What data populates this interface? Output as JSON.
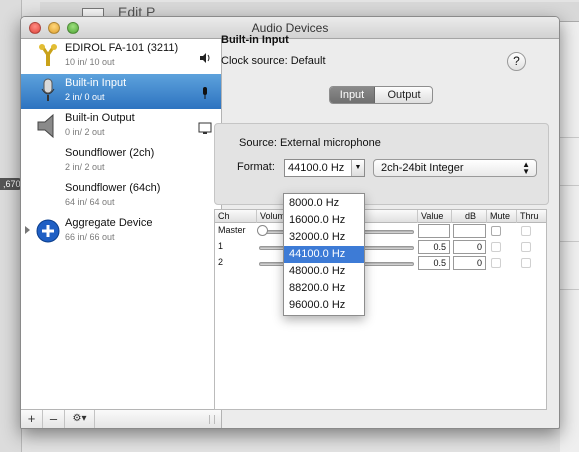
{
  "window": {
    "title": "Audio Devices"
  },
  "background_app": {
    "partial_title": "Edit P",
    "left_badge": ",670"
  },
  "sidebar": {
    "devices": [
      {
        "name": "EDIROL FA-101 (3211)",
        "io": "10 in/ 10 out",
        "icon": "usb-audio-icon",
        "badge": "speaker-icon",
        "selected": false
      },
      {
        "name": "Built-in Input",
        "io": "2 in/ 0 out",
        "icon": "microphone-icon",
        "badge": "microphone-badge-icon",
        "selected": true
      },
      {
        "name": "Built-in Output",
        "io": "0 in/ 2 out",
        "icon": "speaker-device-icon",
        "badge": "display-icon",
        "selected": false
      },
      {
        "name": "Soundflower (2ch)",
        "io": "2 in/ 2 out",
        "icon": "",
        "badge": "",
        "selected": false
      },
      {
        "name": "Soundflower (64ch)",
        "io": "64 in/ 64 out",
        "icon": "",
        "badge": "",
        "selected": false
      },
      {
        "name": "Aggregate Device",
        "io": "66 in/ 66 out",
        "icon": "aggregate-plus-icon",
        "badge": "",
        "selected": false
      }
    ],
    "add_label": "+",
    "remove_label": "–",
    "gear_label": "⚙▾"
  },
  "detail": {
    "device_title": "Built-in Input",
    "clock_source": "Clock source: Default",
    "help_label": "?",
    "tabs": [
      "Input",
      "Output"
    ],
    "active_tab": "Input",
    "source_text": "Source:  External microphone",
    "format_label": "Format:",
    "format_value": "44100.0 Hz",
    "bit_format": "2ch-24bit Integer"
  },
  "channel_table": {
    "headers": [
      "Ch",
      "Volume",
      "Value",
      "dB",
      "Mute",
      "Thru"
    ],
    "rows": [
      {
        "ch": "Master",
        "value": "",
        "db": ""
      },
      {
        "ch": "1",
        "value": "0.5",
        "db": "0"
      },
      {
        "ch": "2",
        "value": "0.5",
        "db": "0"
      }
    ]
  },
  "format_menu": {
    "options": [
      "8000.0 Hz",
      "16000.0 Hz",
      "32000.0 Hz",
      "44100.0 Hz",
      "48000.0 Hz",
      "88200.0 Hz",
      "96000.0 Hz"
    ],
    "selected": "44100.0 Hz"
  },
  "colors": {
    "selection_blue": "#2d73c0",
    "menu_highlight": "#3d7bd6"
  }
}
